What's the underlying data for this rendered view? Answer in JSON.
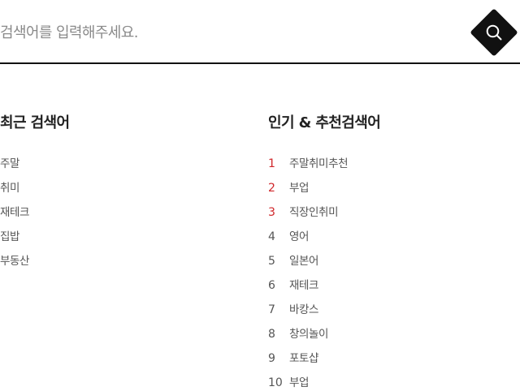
{
  "search": {
    "placeholder": "검색어를 입력해주세요.",
    "value": ""
  },
  "icons": {
    "search_button": "search-icon"
  },
  "colors": {
    "accent": "#111111",
    "rank_highlight": "#d0262a",
    "text_muted": "#555555",
    "placeholder": "#8a8a8a"
  },
  "recent": {
    "title": "최근 검색어",
    "items": [
      "주말",
      "취미",
      "재테크",
      "집밥",
      "부동산"
    ]
  },
  "popular": {
    "title": "인기 & 추천검색어",
    "items": [
      {
        "rank": "1",
        "term": "주말취미추천",
        "highlight": true
      },
      {
        "rank": "2",
        "term": "부업",
        "highlight": true
      },
      {
        "rank": "3",
        "term": "직장인취미",
        "highlight": true
      },
      {
        "rank": "4",
        "term": "영어",
        "highlight": false
      },
      {
        "rank": "5",
        "term": "일본어",
        "highlight": false
      },
      {
        "rank": "6",
        "term": "재테크",
        "highlight": false
      },
      {
        "rank": "7",
        "term": "바캉스",
        "highlight": false
      },
      {
        "rank": "8",
        "term": "창의놀이",
        "highlight": false
      },
      {
        "rank": "9",
        "term": "포토샵",
        "highlight": false
      },
      {
        "rank": "10",
        "term": "부업",
        "highlight": false
      }
    ]
  }
}
